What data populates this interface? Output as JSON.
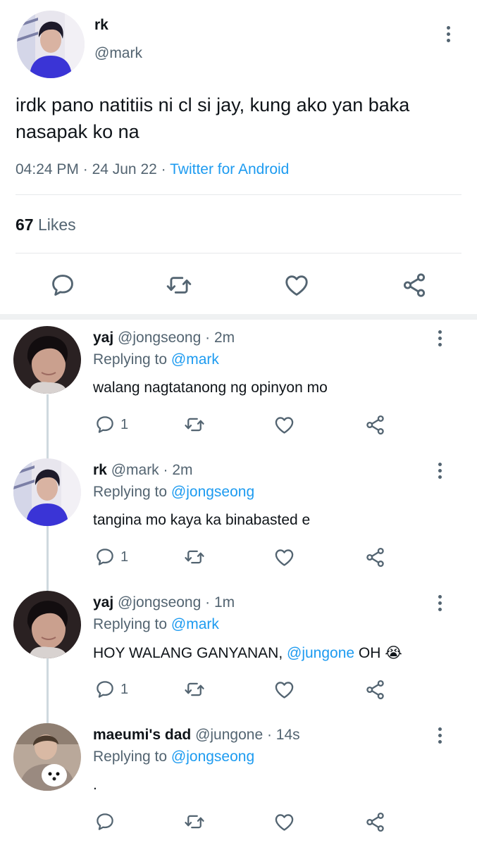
{
  "main": {
    "name": "rk",
    "handle": "@mark",
    "text": "irdk pano natitiis ni cl si jay, kung ako yan baka nasapak ko na",
    "time": "04:24 PM",
    "sep1": " · ",
    "date": "24 Jun 22",
    "sep2": " · ",
    "source": "Twitter for Android",
    "likes_count": "67",
    "likes_label": "Likes"
  },
  "replies": [
    {
      "name": "yaj",
      "handle": "@jongseong",
      "time": "2m",
      "replying_label": "Replying to",
      "replying_to": "@mark",
      "text": "walang nagtatanong ng opinyon mo",
      "reply_count": "1"
    },
    {
      "name": "rk",
      "handle": "@mark",
      "time": "2m",
      "replying_label": "Replying to",
      "replying_to": "@jongseong",
      "text": "tangina mo kaya ka binabasted e",
      "reply_count": "1"
    },
    {
      "name": "yaj",
      "handle": "@jongseong",
      "time": "1m",
      "replying_label": "Replying to",
      "replying_to": "@mark",
      "text_before": "HOY WALANG GANYANAN, ",
      "mention": "@jungone",
      "text_after": " OH ",
      "emoji": "😭",
      "reply_count": "1"
    },
    {
      "name": "maeumi's dad",
      "handle": "@jungone",
      "time": "14s",
      "replying_label": "Replying to",
      "replying_to": "@jongseong",
      "text": "."
    }
  ],
  "dot_sep": " · ",
  "colors": {
    "link": "#1d9bf0",
    "muted": "#536471",
    "text": "#0f1419"
  },
  "icons": [
    "reply-icon",
    "retweet-icon",
    "like-icon",
    "share-icon",
    "more-icon"
  ]
}
